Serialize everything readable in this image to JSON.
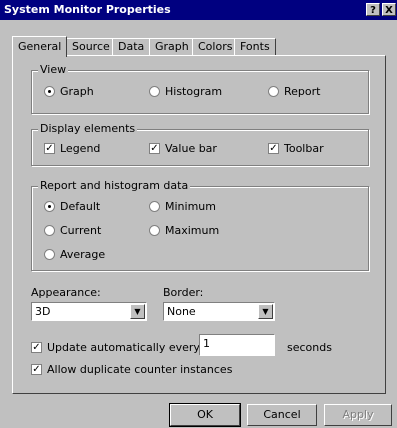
{
  "window": {
    "title": "System Monitor Properties",
    "help_label": "?",
    "close_label": "X"
  },
  "tabs": [
    "General",
    "Source",
    "Data",
    "Graph",
    "Colors",
    "Fonts"
  ],
  "view": {
    "legend": "View",
    "options": [
      "Graph",
      "Histogram",
      "Report"
    ],
    "selected": "Graph"
  },
  "display_elements": {
    "legend": "Display elements",
    "items": [
      {
        "label": "Legend",
        "checked": true
      },
      {
        "label": "Value bar",
        "checked": true
      },
      {
        "label": "Toolbar",
        "checked": true
      }
    ]
  },
  "report_data": {
    "legend": "Report and histogram data",
    "options": [
      "Default",
      "Current",
      "Average",
      "Minimum",
      "Maximum"
    ],
    "selected": "Default"
  },
  "appearance": {
    "label": "Appearance:",
    "value": "3D"
  },
  "border": {
    "label": "Border:",
    "value": "None"
  },
  "update": {
    "label": "Update automatically every:",
    "value": "1",
    "unit": "seconds",
    "checked": true
  },
  "duplicates": {
    "label": "Allow duplicate counter instances",
    "checked": true
  },
  "buttons": {
    "ok": "OK",
    "cancel": "Cancel",
    "apply": "Apply"
  }
}
